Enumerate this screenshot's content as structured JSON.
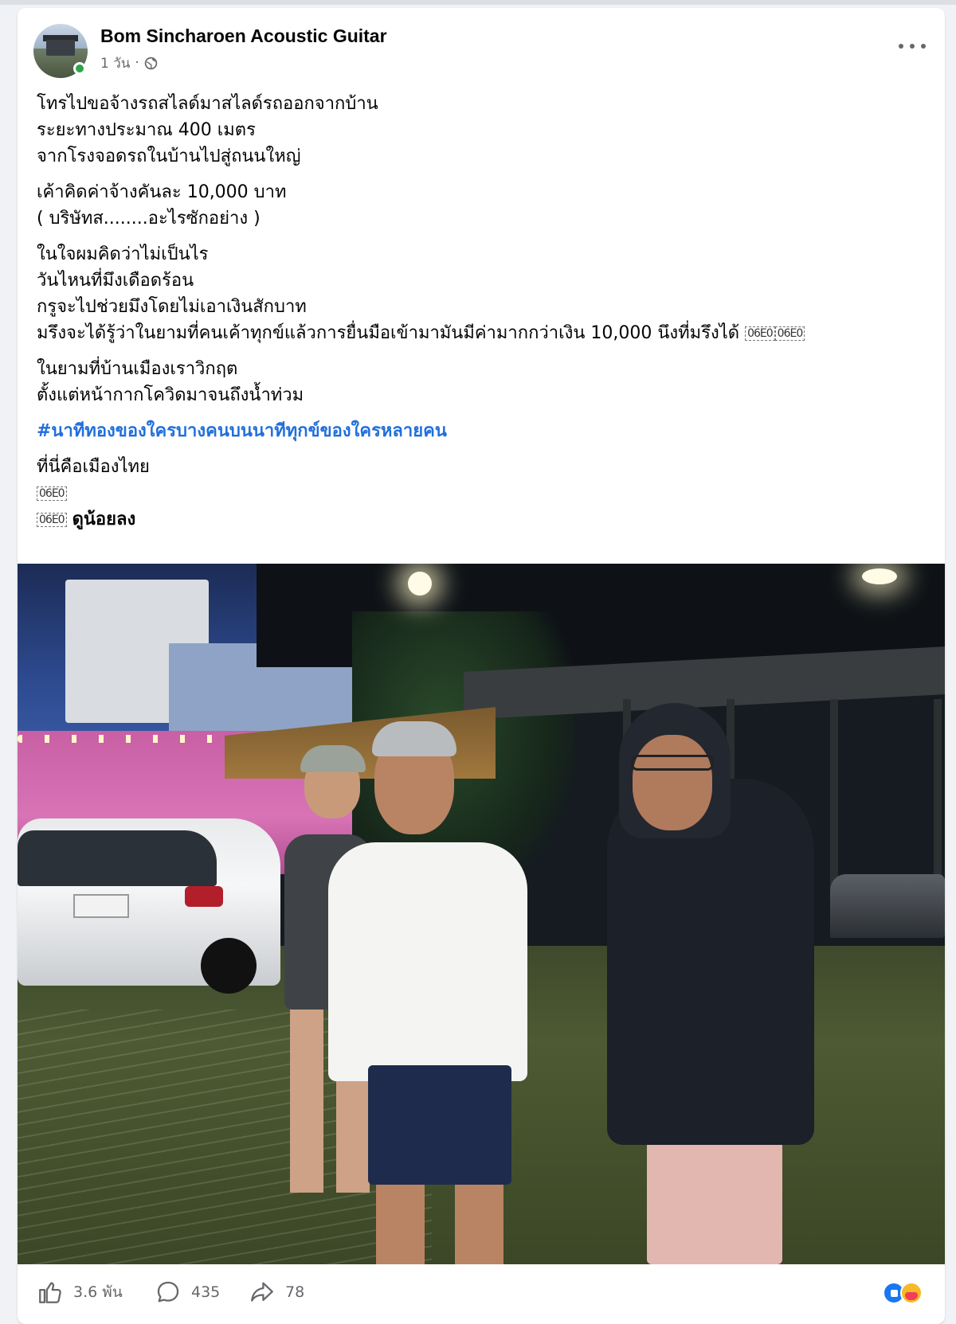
{
  "post": {
    "author": "Bom Sincharoen Acoustic Guitar",
    "time": "1 วัน",
    "separator": "·",
    "privacy_icon": "globe-icon",
    "menu_icon": "more-icon",
    "paragraphs": [
      [
        "โทรไปขอจ้างรถสไลด์มาสไลด์รถออกจากบ้าน",
        "ระยะทางประมาณ 400 เมตร",
        "จากโรงจอดรถในบ้านไปสู่ถนนใหญ่"
      ],
      [
        "เค้าคิดค่าจ้างคันละ 10,000 บาท",
        "( บริษัทส........อะไรซักอย่าง )"
      ],
      [
        "ในใจผมคิดว่าไม่เป็นไร",
        "วันไหนที่มึงเดือดร้อน",
        "กรูจะไปช่วยมึงโดยไม่เอาเงินสักบาท",
        "มรึงจะได้รู้ว่าในยามที่คนเค้าทุกข์แล้วการยื่นมือเข้ามามันมีค่ามากกว่าเงิน 10,000 นึงที่มรึงได้"
      ],
      [
        "ในยามที่บ้านเมืองเราวิกฤต",
        "ตั้งแต่หน้ากากโควิดมาจนถึงน้ำท่วม"
      ]
    ],
    "hashtag": "#นาทีทองของใครบางคนบนนาทีทุกข์ของใครหลายคน",
    "closing": "ที่นี่คือเมืองไทย",
    "emoji_placeholder": "06E0",
    "see_less": "ดูน้อยลง"
  },
  "actions": {
    "likes": "3.6 พัน",
    "comments": "435",
    "shares": "78"
  },
  "colors": {
    "hashtag": "#216fdb",
    "secondary_text": "#65676b",
    "online": "#31a24c",
    "like_reaction": "#1877f2"
  }
}
